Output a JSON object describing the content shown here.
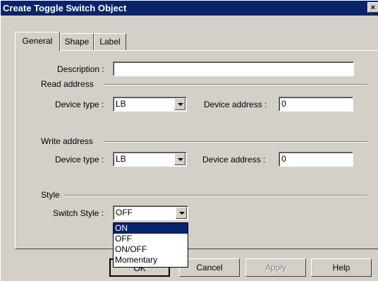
{
  "window": {
    "title": "Create Toggle Switch Object",
    "close_glyph": "×"
  },
  "tabs": [
    {
      "label": "General",
      "active": true
    },
    {
      "label": "Shape",
      "active": false
    },
    {
      "label": "Label",
      "active": false
    }
  ],
  "general": {
    "description_label": "Description :",
    "description_value": "",
    "read_section": "Read address",
    "read_device_type_label": "Device type :",
    "read_device_type_value": "LB",
    "read_device_address_label": "Device address :",
    "read_device_address_value": "0",
    "write_section": "Write address",
    "write_device_type_label": "Device type :",
    "write_device_type_value": "LB",
    "write_device_address_label": "Device  address :",
    "write_device_address_value": "0",
    "style_section": "Style",
    "switch_style_label": "Switch Style :",
    "switch_style_value": "OFF",
    "switch_style_options": [
      "ON",
      "OFF",
      "ON/OFF",
      "Momentary"
    ],
    "switch_style_highlighted": "ON"
  },
  "buttons": {
    "ok": "OK",
    "cancel": "Cancel",
    "apply": "Apply",
    "help": "Help"
  }
}
